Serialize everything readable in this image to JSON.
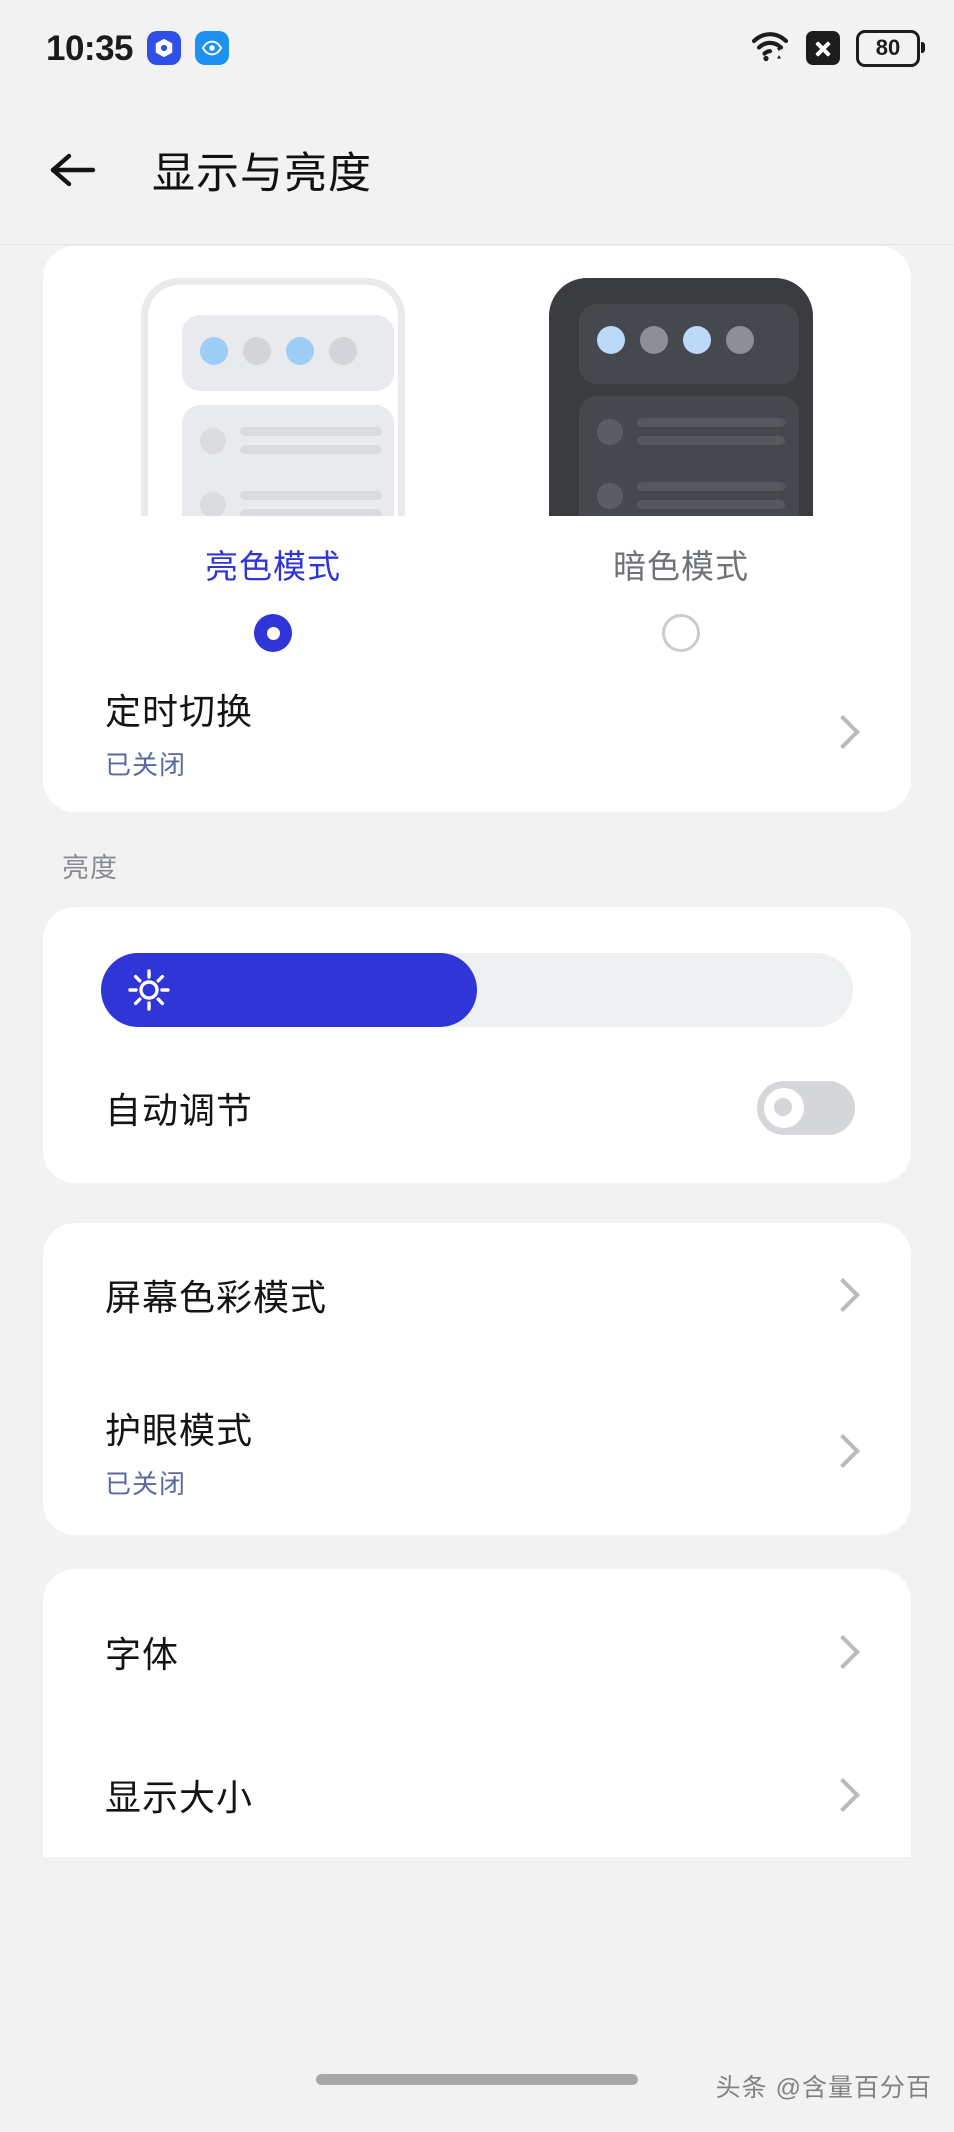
{
  "status_bar": {
    "time": "10:35",
    "app_icons": [
      {
        "name": "settings-gem-icon",
        "color": "#2f4fe8"
      },
      {
        "name": "eye-care-icon",
        "color": "#1e90ef"
      }
    ],
    "wifi_icon": "wifi-icon",
    "sim_icon": "sim-disabled-icon",
    "battery_level": "80"
  },
  "header": {
    "back_icon": "back-arrow-icon",
    "title": "显示与亮度"
  },
  "theme": {
    "options": [
      {
        "label": "亮色模式",
        "selected": true
      },
      {
        "label": "暗色模式",
        "selected": false
      }
    ],
    "schedule_row": {
      "title": "定时切换",
      "subtitle": "已关闭"
    }
  },
  "brightness": {
    "section_label": "亮度",
    "slider": {
      "icon": "sun-icon",
      "value_percent": 50
    },
    "auto_row": {
      "title": "自动调节",
      "toggle_on": false
    }
  },
  "display_card": {
    "rows": [
      {
        "title": "屏幕色彩模式",
        "subtitle": ""
      },
      {
        "title": "护眼模式",
        "subtitle": "已关闭"
      }
    ]
  },
  "font_card": {
    "rows": [
      {
        "title": "字体",
        "subtitle": ""
      },
      {
        "title": "显示大小",
        "subtitle": ""
      }
    ]
  },
  "watermark": "头条 @含量百分百",
  "colors": {
    "accent": "#2f35d6",
    "page_bg": "#f2f2f2",
    "card_bg": "#ffffff",
    "subtitle": "#5a6a9e"
  }
}
